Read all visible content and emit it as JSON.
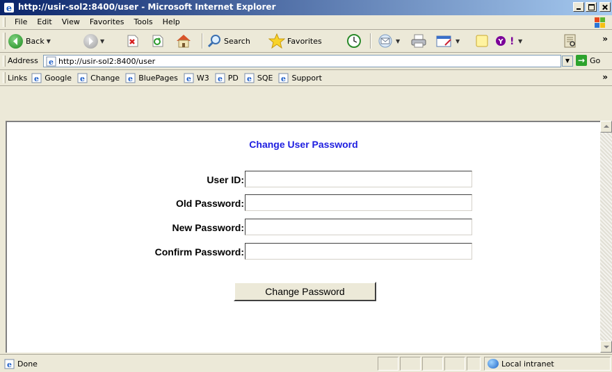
{
  "window": {
    "title": "http://usir-sol2:8400/user - Microsoft Internet Explorer"
  },
  "menu": {
    "items": [
      "File",
      "Edit",
      "View",
      "Favorites",
      "Tools",
      "Help"
    ]
  },
  "toolbar": {
    "back_label": "Back",
    "search_label": "Search",
    "favorites_label": "Favorites"
  },
  "address": {
    "label": "Address",
    "url": "http://usir-sol2:8400/user",
    "go_label": "Go"
  },
  "links": {
    "label": "Links",
    "items": [
      "Google",
      "Change",
      "BluePages",
      "W3",
      "PD",
      "SQE",
      "Support"
    ]
  },
  "form": {
    "heading": "Change User Password",
    "user_id_label": "User ID:",
    "old_password_label": "Old Password:",
    "new_password_label": "New Password:",
    "confirm_password_label": "Confirm Password:",
    "user_id_value": "",
    "old_password_value": "",
    "new_password_value": "",
    "confirm_password_value": "",
    "submit_label": "Change Password"
  },
  "status": {
    "text": "Done",
    "zone": "Local intranet"
  },
  "icons": {
    "back": "back-arrow-icon",
    "forward": "forward-arrow-icon",
    "stop": "stop-icon",
    "refresh": "refresh-icon",
    "home": "home-icon",
    "search": "search-icon",
    "favorites": "favorites-star-icon",
    "history": "history-icon",
    "mail": "mail-icon",
    "print": "print-icon",
    "edit": "edit-icon",
    "messenger": "messenger-icon",
    "yahoo": "yahoo-icon",
    "research": "research-icon",
    "page": "ie-page-icon",
    "go": "go-arrow-icon",
    "zone": "local-intranet-icon"
  }
}
